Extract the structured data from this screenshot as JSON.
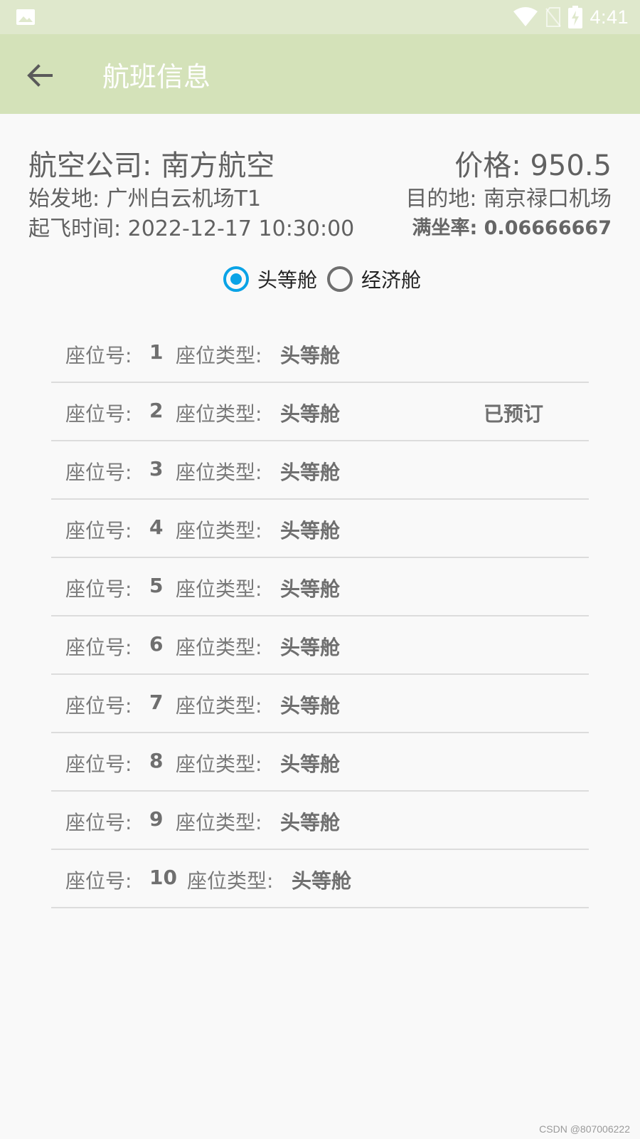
{
  "status_bar": {
    "time": "4:41"
  },
  "appbar": {
    "title": "航班信息"
  },
  "flight": {
    "airline": "航空公司: 南方航空",
    "price": "价格: 950.5",
    "origin": "始发地: 广州白云机场T1",
    "destination": "目的地: 南京禄口机场",
    "departure_time": "起飞时间: 2022-12-17 10:30:00",
    "occupancy": "满坐率: 0.06666667"
  },
  "cabin_options": [
    {
      "label": "头等舱",
      "checked": true
    },
    {
      "label": "经济舱",
      "checked": false
    }
  ],
  "seat_labels": {
    "seat_no": "座位号:",
    "seat_type": "座位类型:"
  },
  "seats": [
    {
      "no": "1",
      "type": "头等舱",
      "status": ""
    },
    {
      "no": "2",
      "type": "头等舱",
      "status": "已预订"
    },
    {
      "no": "3",
      "type": "头等舱",
      "status": ""
    },
    {
      "no": "4",
      "type": "头等舱",
      "status": ""
    },
    {
      "no": "5",
      "type": "头等舱",
      "status": ""
    },
    {
      "no": "6",
      "type": "头等舱",
      "status": ""
    },
    {
      "no": "7",
      "type": "头等舱",
      "status": ""
    },
    {
      "no": "8",
      "type": "头等舱",
      "status": ""
    },
    {
      "no": "9",
      "type": "头等舱",
      "status": ""
    },
    {
      "no": "10",
      "type": "头等舱",
      "status": ""
    }
  ],
  "watermark": "CSDN @807006222",
  "colors": {
    "appbar": "#d4e2b9",
    "statusbar": "#dfe8cc",
    "radio_accent": "#0aa3e6"
  }
}
